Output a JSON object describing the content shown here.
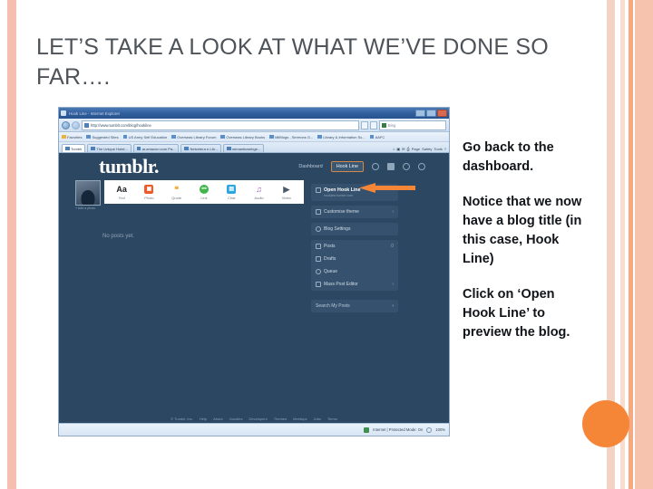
{
  "slide": {
    "title": "LET’S TAKE A LOOK AT WHAT WE’VE DONE SO FAR…."
  },
  "notes": {
    "paragraph_1": "Go back to the dashboard.",
    "paragraph_2": "Notice that we now have a blog title (in this case, Hook Line)",
    "paragraph_3": "Click on ‘Open Hook Line’ to preview the blog."
  },
  "browser": {
    "window_title": "Hook Line - Internet Explorer",
    "address_url": "http://www.tumblr.com/blog/hookline",
    "search_placeholder": "Bing",
    "favorites_label": "Favorites",
    "favorites": [
      "Suggested Sites",
      "US Army Self Education",
      "Overseas Library Forum",
      "Overseas Library Books",
      "MilBlogs - Sermons G...",
      "Library & Information Sc...",
      "AAFC"
    ],
    "tabs": [
      {
        "label": "Tumblr",
        "active": true
      },
      {
        "label": "The Unique Hotel...",
        "active": false
      },
      {
        "label": "ar.amazon.com Pa...",
        "active": false
      },
      {
        "label": "Netcetera e-Lib...",
        "active": false
      },
      {
        "label": "semanticwebge...",
        "active": false
      }
    ],
    "toolbar": [
      "Page",
      "Safety",
      "Tools"
    ],
    "status": {
      "zone": "Internet | Protected Mode: On",
      "zoom": "100%"
    }
  },
  "tumblr": {
    "logo": "tumblr.",
    "header_links": {
      "dashboard": "Dashboard",
      "blog_title": "Hook Line"
    },
    "avatar_caption": "+ Add a photo",
    "post_types": [
      {
        "label": "Text",
        "glyph": "Aa",
        "color": "#1c1f23"
      },
      {
        "label": "Photo",
        "glyph": "▣",
        "color": "#f05a28"
      },
      {
        "label": "Quote",
        "glyph": "❝",
        "color": "#f5a623"
      },
      {
        "label": "Link",
        "glyph": "⚯",
        "color": "#3fb54a"
      },
      {
        "label": "Chat",
        "glyph": "▤",
        "color": "#2ba6e0"
      },
      {
        "label": "Audio",
        "glyph": "♫",
        "color": "#9b59b6"
      },
      {
        "label": "Video",
        "glyph": "▶",
        "color": "#4a5a6a"
      }
    ],
    "empty_state": "No posts yet.",
    "sidebar": {
      "open_blog": {
        "label": "Open Hook Line",
        "url": "hookline.tumblr.com"
      },
      "customise": "Customise theme",
      "blog_settings": "Blog Settings",
      "items": [
        {
          "label": "Posts",
          "badge": "0"
        },
        {
          "label": "Drafts",
          "badge": ""
        },
        {
          "label": "Queue",
          "badge": ""
        },
        {
          "label": "Mass Post Editor",
          "badge": ""
        }
      ],
      "search": "Search My Posts"
    },
    "footer": [
      "© Tumblr, Inc.",
      "Help",
      "About",
      "Goodies",
      "Developers",
      "Themes",
      "Meetups",
      "Jobs",
      "Terms"
    ]
  },
  "colors": {
    "accent_orange": "#f58637",
    "stripe_peach": "#f4bfae",
    "title_gray": "#4d5358",
    "tumblr_navy": "#2c4762"
  }
}
